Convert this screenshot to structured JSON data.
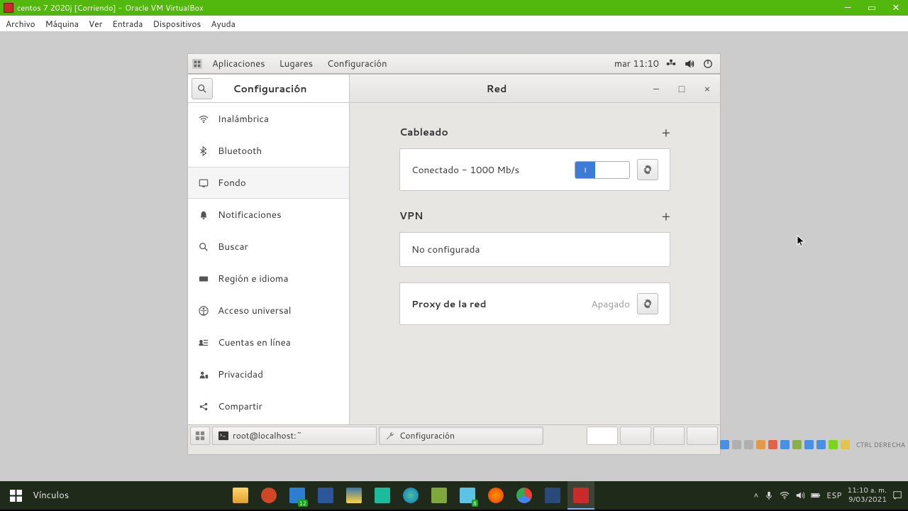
{
  "vbox": {
    "title": "centos 7 2020j [Corriendo] - Oracle VM VirtualBox",
    "menu": [
      "Archivo",
      "Máquina",
      "Ver",
      "Entrada",
      "Dispositivos",
      "Ayuda"
    ],
    "host_key": "CTRL DERECHA"
  },
  "gnome": {
    "apps": "Aplicaciones",
    "places": "Lugares",
    "app_title": "Configuración",
    "clock": "mar 11:10"
  },
  "settings": {
    "sidebar_title": "Configuración",
    "items": [
      {
        "label": "Inalámbrica"
      },
      {
        "label": "Bluetooth"
      },
      {
        "label": "Fondo"
      },
      {
        "label": "Notificaciones"
      },
      {
        "label": "Buscar"
      },
      {
        "label": "Región e idioma"
      },
      {
        "label": "Acceso universal"
      },
      {
        "label": "Cuentas en línea"
      },
      {
        "label": "Privacidad"
      },
      {
        "label": "Compartir"
      }
    ],
    "main_title": "Red",
    "wired": {
      "heading": "Cableado",
      "status": "Conectado - 1000 Mb/s",
      "toggle_on": "I"
    },
    "vpn": {
      "heading": "VPN",
      "status": "No configurada"
    },
    "proxy": {
      "heading": "Proxy de la red",
      "status": "Apagado"
    }
  },
  "taskbar_guest": {
    "terminal": "root@localhost:~",
    "settings": "Configuración"
  },
  "windows": {
    "vinculos": "Vínculos",
    "lang": "ESP",
    "time": "11:10 a. m.",
    "date": "9/03/2021"
  }
}
